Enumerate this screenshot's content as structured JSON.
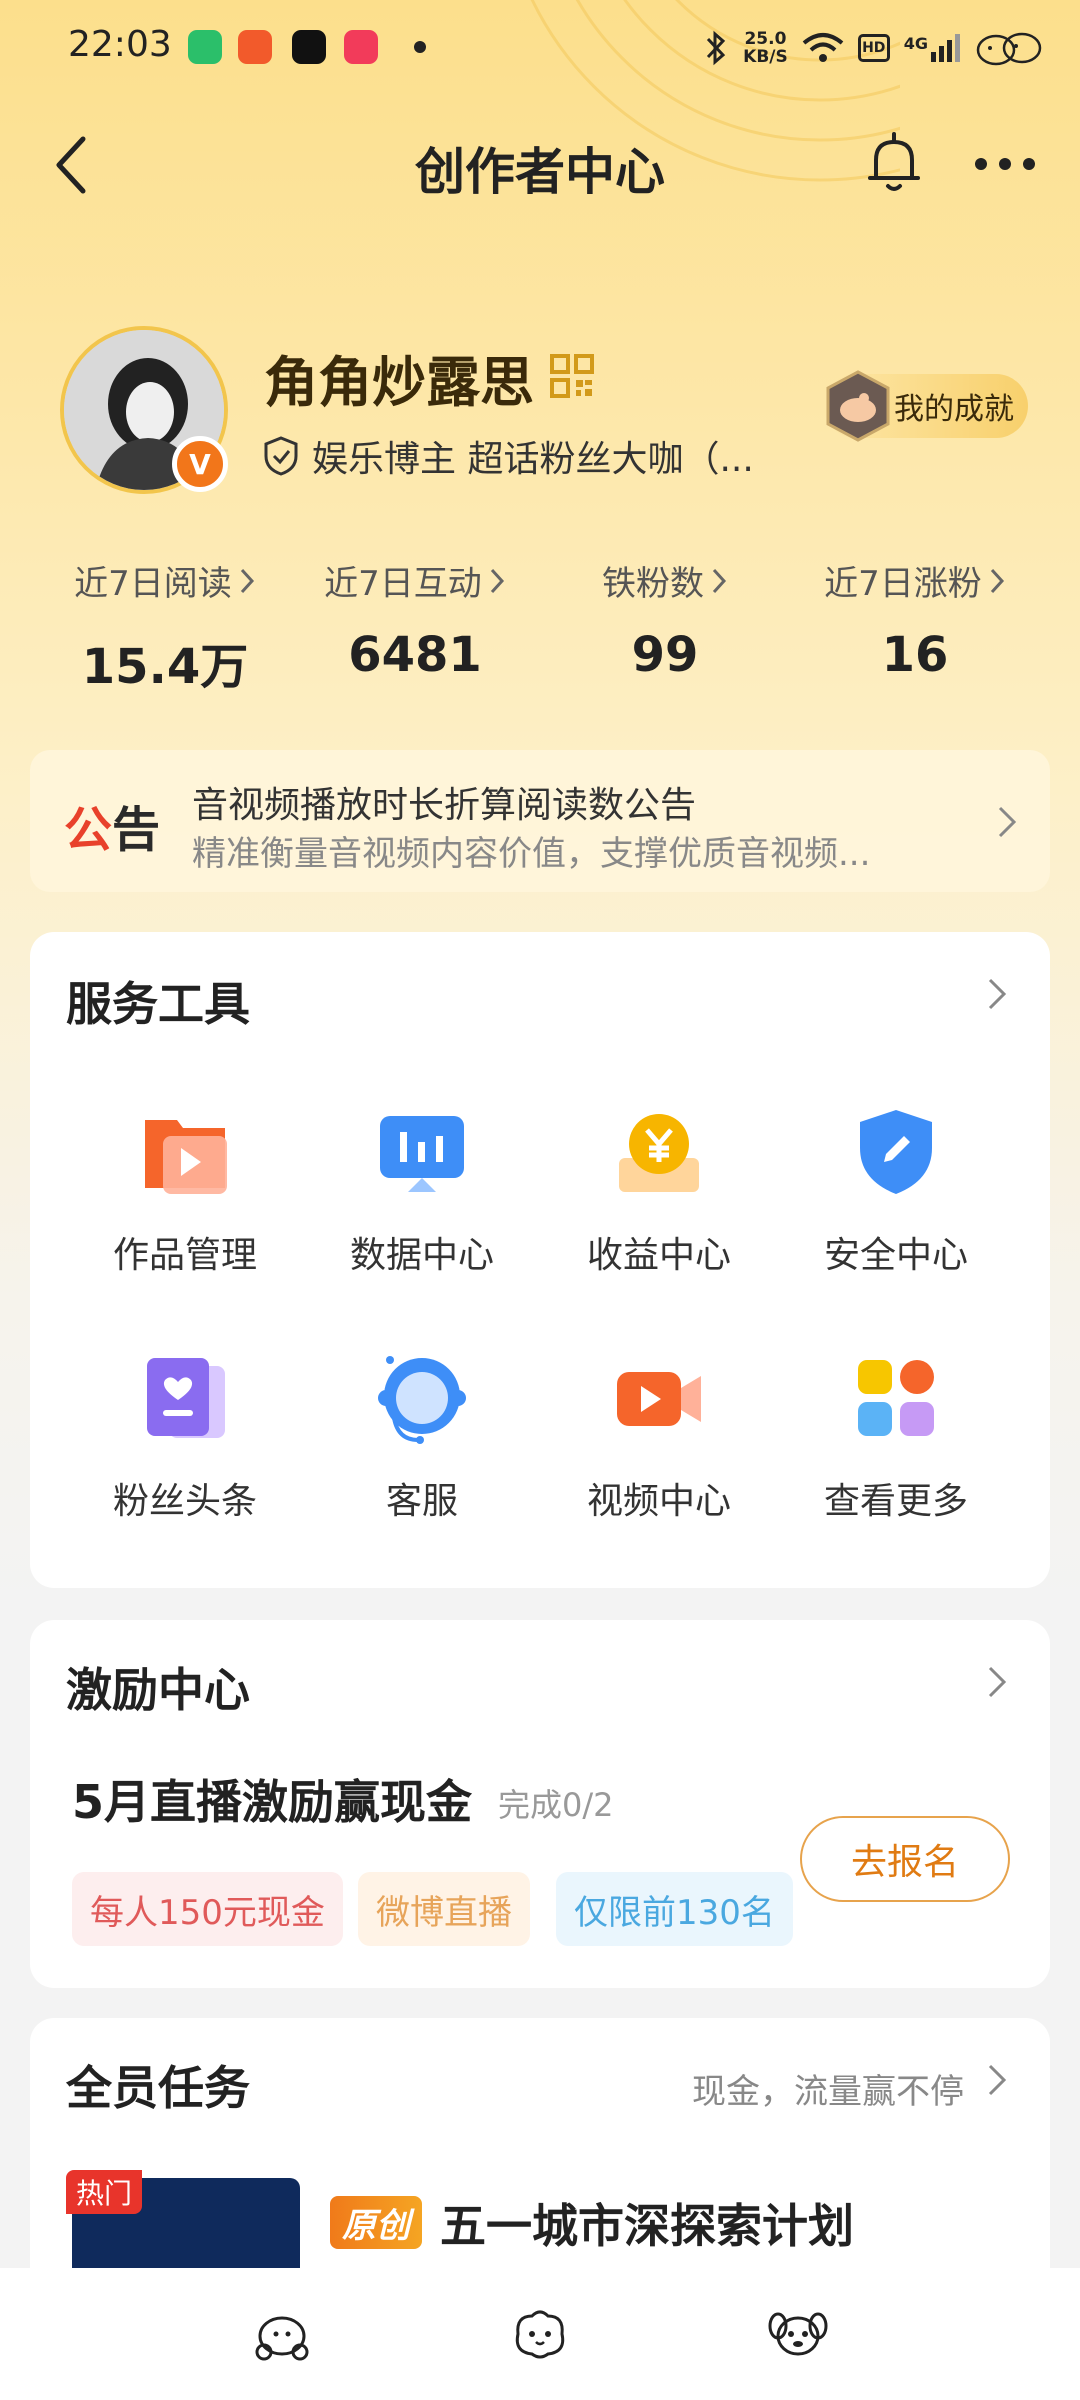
{
  "status_bar": {
    "time": "22:03",
    "net_speed_value": "25.0",
    "net_speed_unit": "KB/S",
    "hd_label": "HD",
    "network_label": "4G",
    "icons": [
      "battery-saver-icon",
      "shopping-app-icon",
      "tiktok-icon",
      "music-app-icon",
      "bluetooth-icon",
      "wifi-icon",
      "signal-icon",
      "status-mascot-icon"
    ]
  },
  "nav": {
    "title": "创作者中心",
    "back_icon": "chevron-left-icon",
    "bell_icon": "bell-icon",
    "more_icon": "more-icon"
  },
  "profile": {
    "username": "角角炒露思",
    "verify_text": "娱乐博主 超话粉丝大咖（...",
    "v_badge": "V",
    "achievement_label": "我的成就"
  },
  "stats": [
    {
      "label": "近7日阅读",
      "value": "15.4万"
    },
    {
      "label": "近7日互动",
      "value": "6481"
    },
    {
      "label": "铁粉数",
      "value": "99"
    },
    {
      "label": "近7日涨粉",
      "value": "16"
    }
  ],
  "notice": {
    "tag_part1": "公",
    "tag_part2": "告",
    "title": "音视频播放时长折算阅读数公告",
    "subtitle": "精准衡量音视频内容价值，支撑优质音视频..."
  },
  "service_tools": {
    "title": "服务工具",
    "items": [
      {
        "label": "作品管理",
        "icon": "works-folder-icon"
      },
      {
        "label": "数据中心",
        "icon": "data-monitor-icon"
      },
      {
        "label": "收益中心",
        "icon": "yuan-coin-icon"
      },
      {
        "label": "安全中心",
        "icon": "shield-icon"
      },
      {
        "label": "粉丝头条",
        "icon": "fan-heart-card-icon"
      },
      {
        "label": "客服",
        "icon": "headset-icon"
      },
      {
        "label": "视频中心",
        "icon": "video-camera-icon"
      },
      {
        "label": "查看更多",
        "icon": "grid-more-icon"
      }
    ],
    "colors": {
      "orange": "#f5652b",
      "blue": "#3e8ef7",
      "yellow": "#f7b500",
      "purple": "#8a6cf0"
    }
  },
  "incentive": {
    "title": "激励中心",
    "campaign_title": "5月直播激励赢现金",
    "progress": "完成0/2",
    "tags": [
      "每人150元现金",
      "微博直播",
      "仅限前130名"
    ],
    "signup_label": "去报名"
  },
  "tasks": {
    "title": "全员任务",
    "subtitle": "现金，流量赢不停",
    "hot_badge": "热门",
    "original_badge": "原创",
    "task_title": "五一城市深探索计划"
  },
  "bottom_bar": {
    "icons": [
      "mascot-tab-icon-1",
      "mascot-tab-icon-2",
      "mascot-tab-icon-3"
    ]
  },
  "accent_color": "#e07b13"
}
